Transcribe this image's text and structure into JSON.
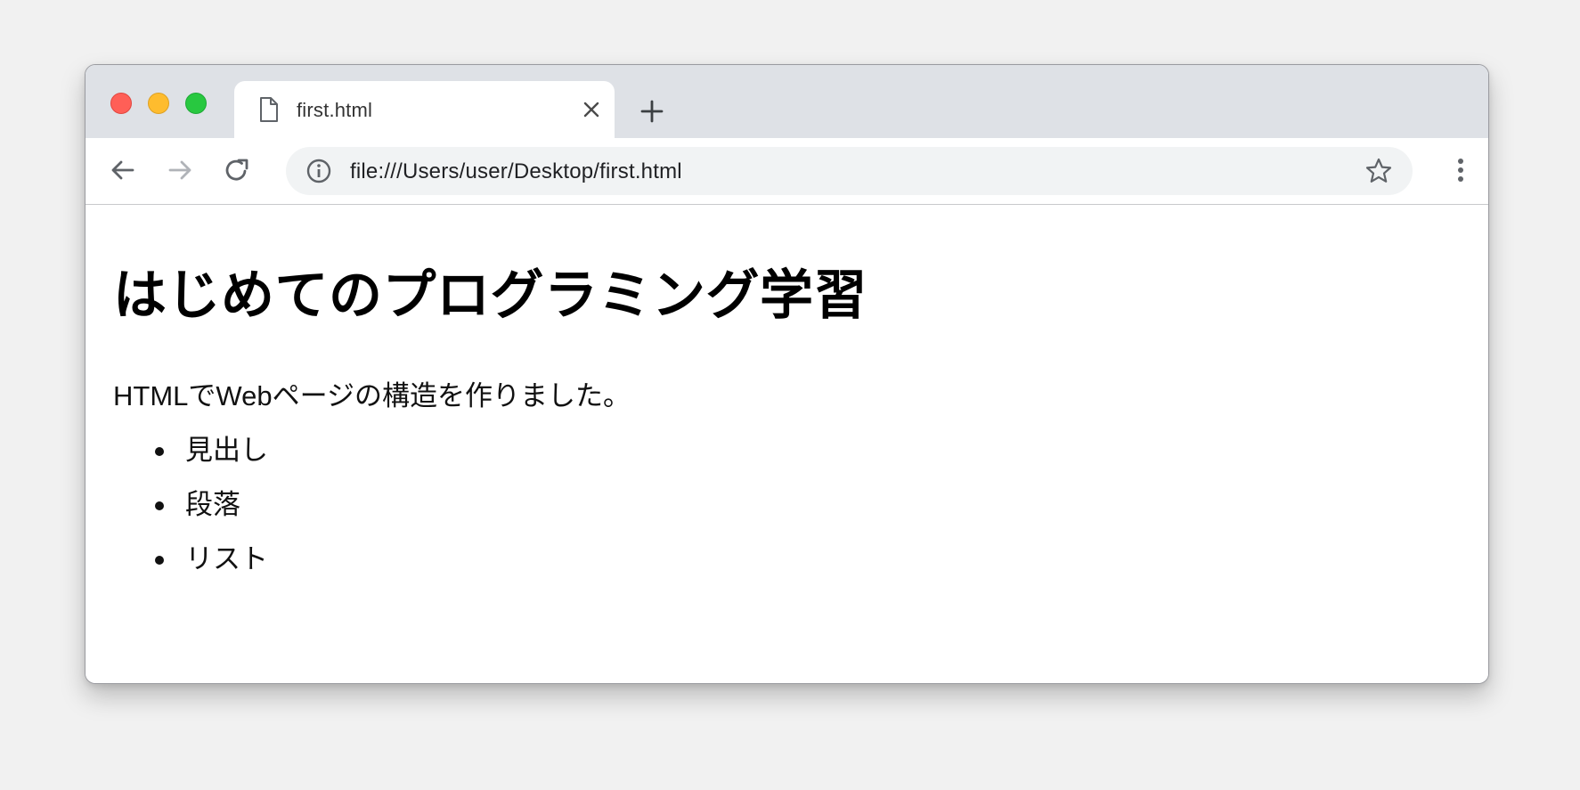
{
  "window": {
    "traffic_lights": [
      "close",
      "minimize",
      "zoom"
    ],
    "colors": {
      "close": "#ff5f57",
      "minimize": "#febc2e",
      "zoom": "#28c840"
    }
  },
  "tab": {
    "title": "first.html",
    "icon": "file-icon",
    "close_icon": "close-icon"
  },
  "new_tab": {
    "icon": "plus-icon"
  },
  "toolbar": {
    "back_icon": "arrow-left-icon",
    "forward_icon": "arrow-right-icon",
    "reload_icon": "reload-icon",
    "info_icon": "info-icon",
    "url": "file:///Users/user/Desktop/first.html",
    "bookmark_icon": "star-icon",
    "menu_icon": "more-vertical-icon"
  },
  "page": {
    "heading": "はじめてのプログラミング学習",
    "paragraph": "HTMLでWebページの構造を作りました。",
    "list": [
      "見出し",
      "段落",
      "リスト"
    ]
  }
}
